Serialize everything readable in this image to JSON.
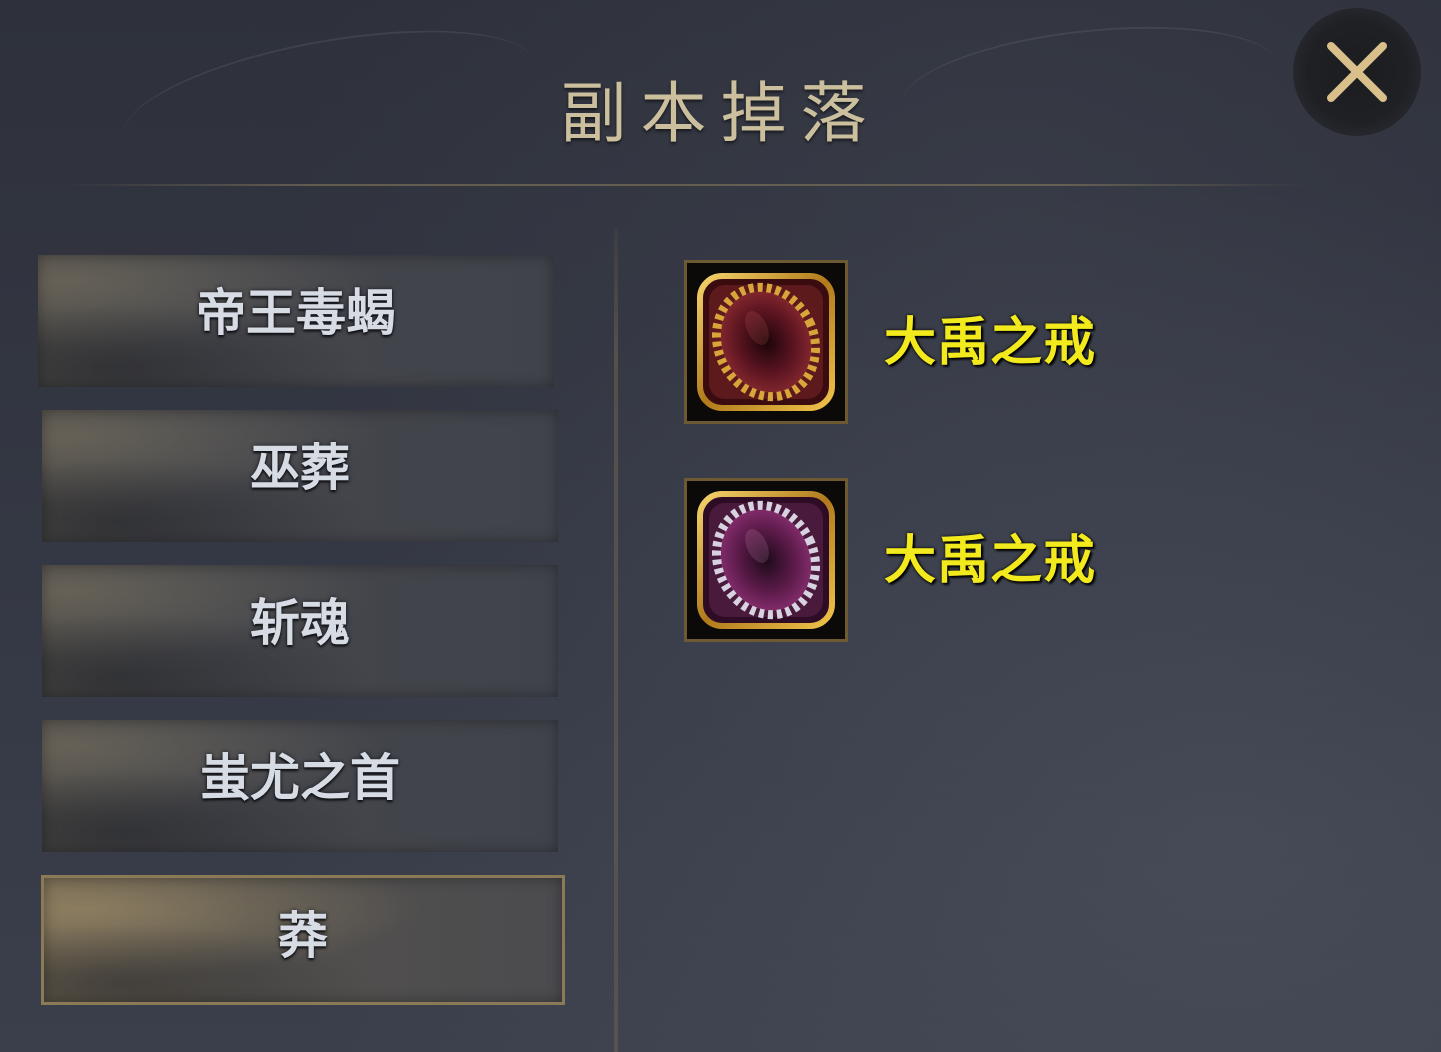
{
  "window": {
    "title": "副本掉落",
    "close_icon": "close-x-icon"
  },
  "colors": {
    "title": "#cbbf9e",
    "item_name": "#f2ea1c",
    "boss_label": "#d7dbe4",
    "selected_border": "#8b7a56"
  },
  "bosses": [
    {
      "label": "帝王毒蝎",
      "selected": false
    },
    {
      "label": "巫葬",
      "selected": false
    },
    {
      "label": "斩魂",
      "selected": false
    },
    {
      "label": "蚩尤之首",
      "selected": false
    },
    {
      "label": "莽",
      "selected": true
    }
  ],
  "drops": [
    {
      "name": "大禹之戒",
      "icon": "gold-ring-icon"
    },
    {
      "name": "大禹之戒",
      "icon": "silver-ring-icon"
    }
  ]
}
